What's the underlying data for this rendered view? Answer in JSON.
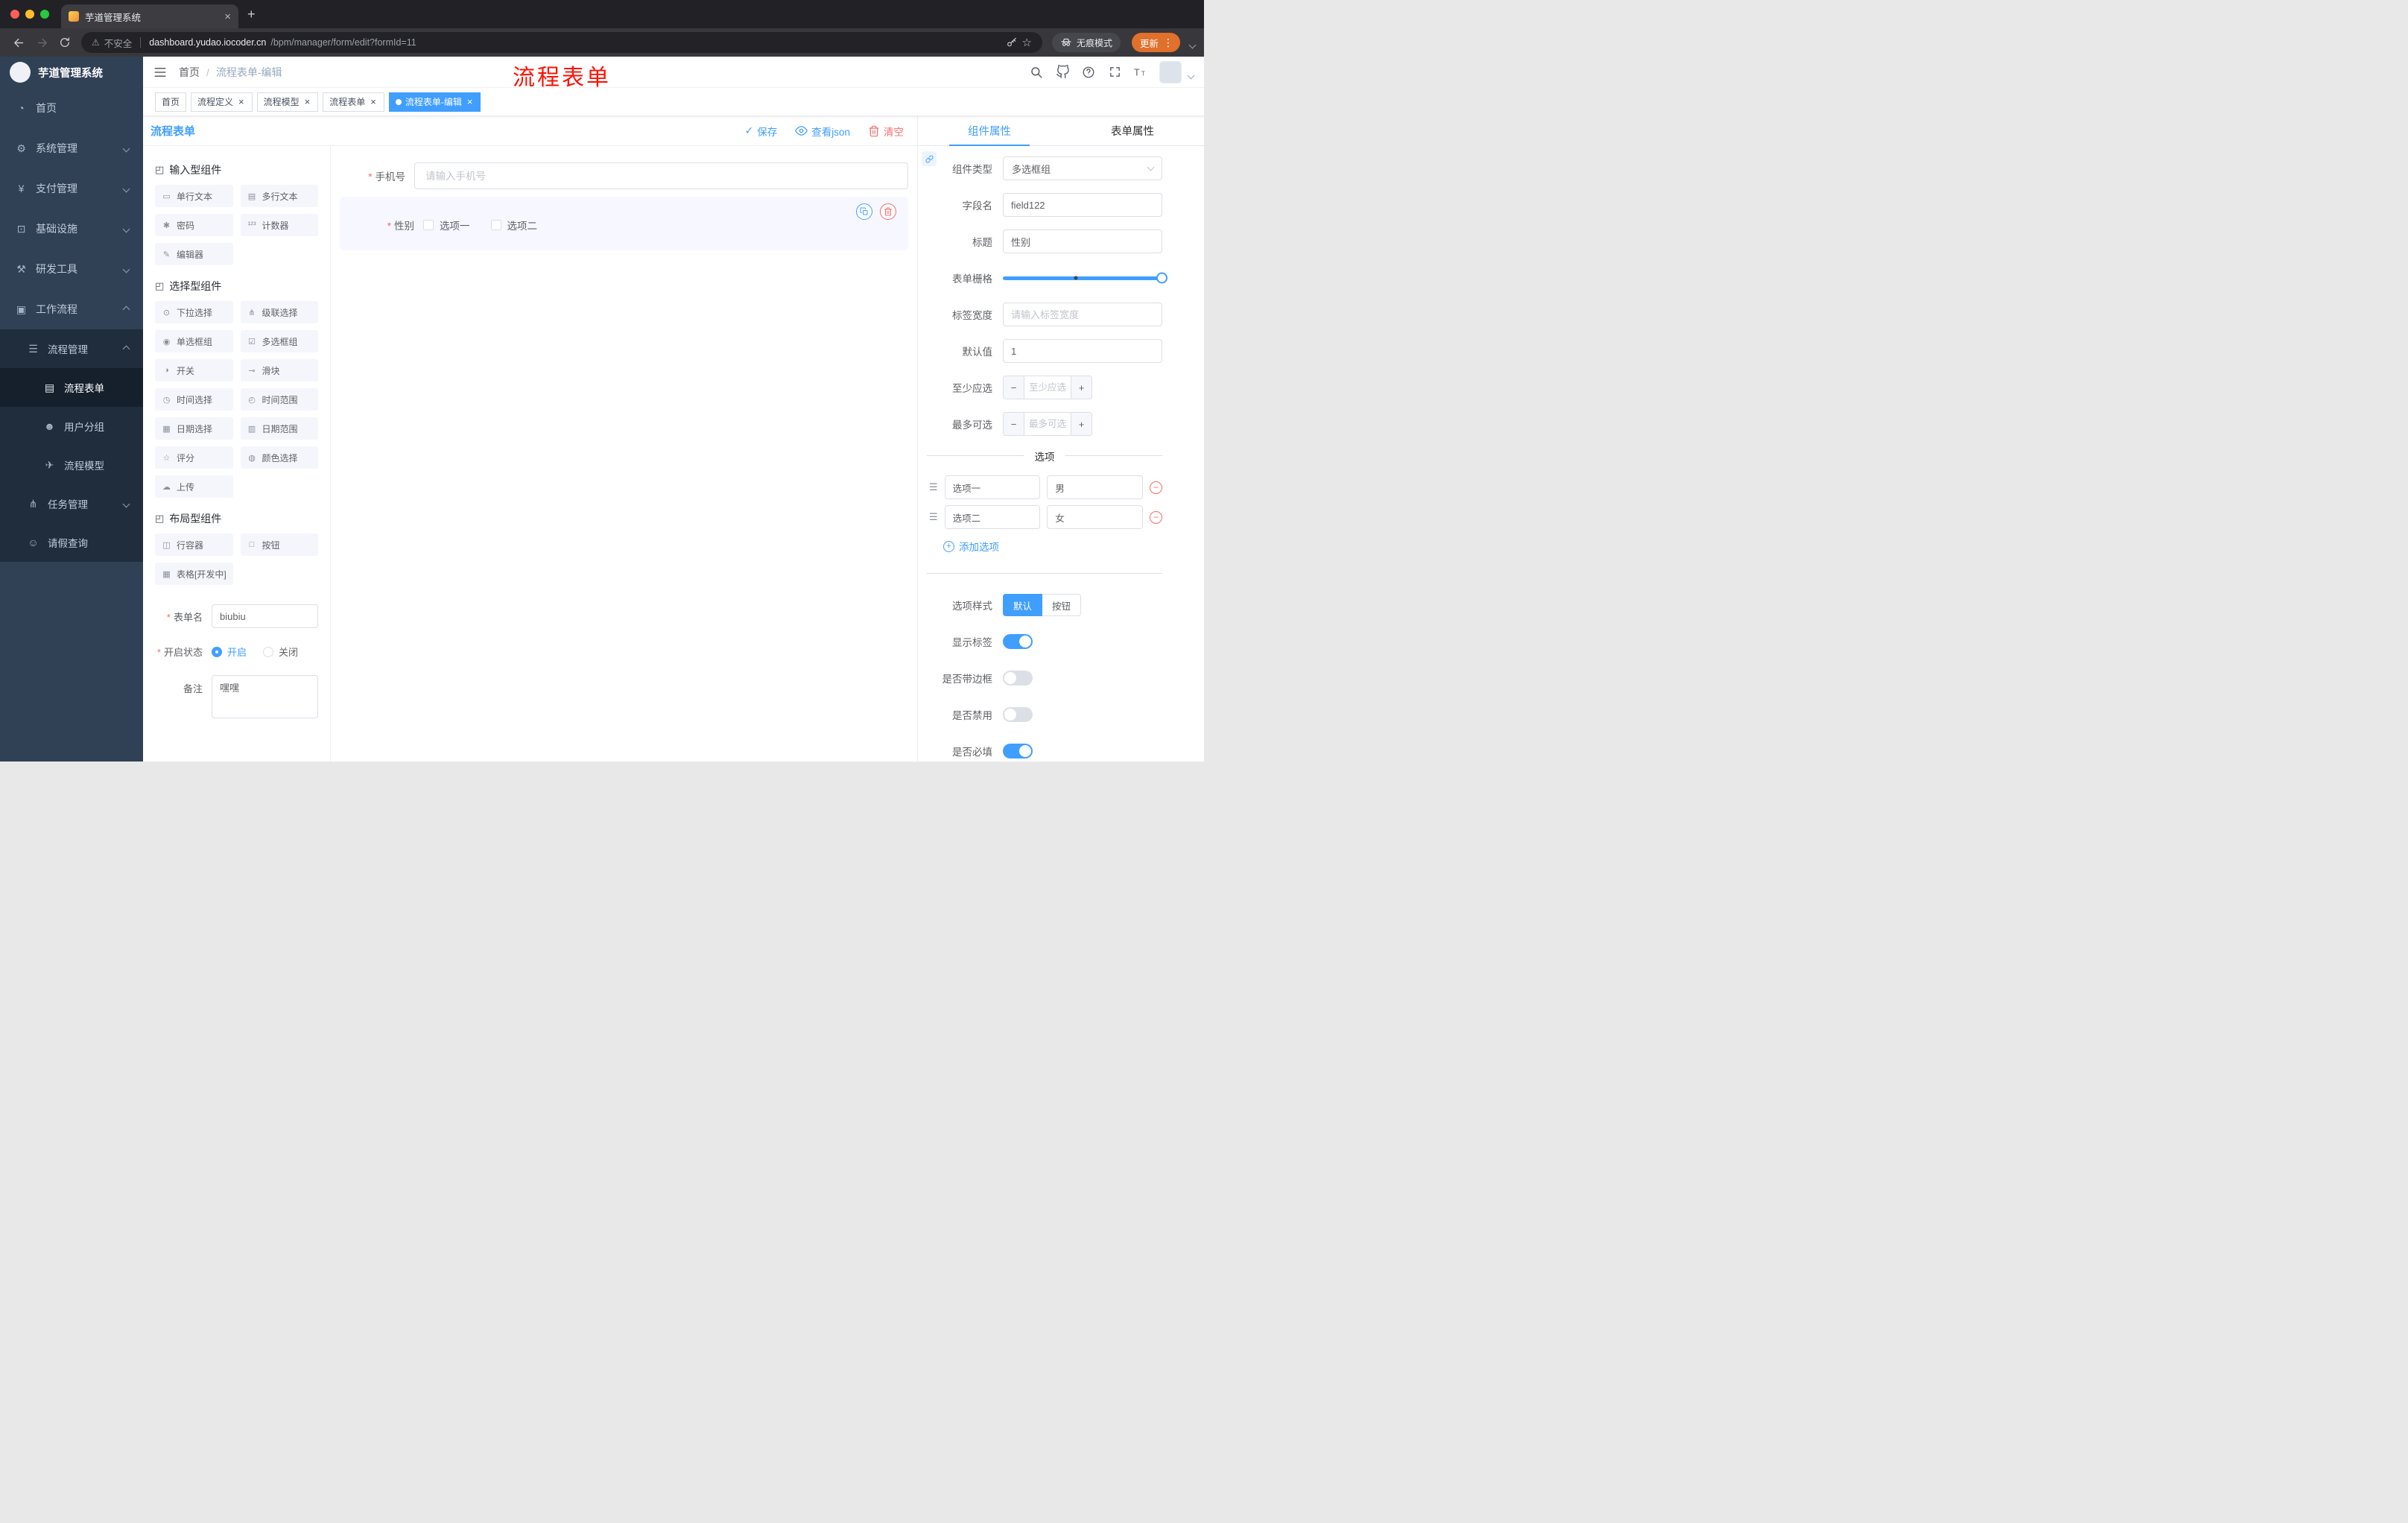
{
  "browser": {
    "tab_title": "芋道管理系统",
    "security_label": "不安全",
    "url_host": "dashboard.yudao.iocoder.cn",
    "url_path": "/bpm/manager/form/edit?formId=11",
    "incognito_label": "无痕模式",
    "update_label": "更新"
  },
  "annotation": {
    "text": "流程表单"
  },
  "sidebar": {
    "logo_title": "芋道管理系统",
    "menu": [
      {
        "label": "首页",
        "icon": "dashboard",
        "caret": ""
      },
      {
        "label": "系统管理",
        "icon": "gear",
        "caret": "down"
      },
      {
        "label": "支付管理",
        "icon": "yen",
        "caret": "down"
      },
      {
        "label": "基础设施",
        "icon": "monitor",
        "caret": "down"
      },
      {
        "label": "研发工具",
        "icon": "tools",
        "caret": "down"
      },
      {
        "label": "工作流程",
        "icon": "workflow",
        "caret": "up"
      }
    ],
    "submenu": [
      {
        "label": "流程管理",
        "icon": "list",
        "caret": "up"
      },
      {
        "label": "流程表单",
        "icon": "document",
        "sub": true,
        "active": true
      },
      {
        "label": "用户分组",
        "icon": "users",
        "sub": true
      },
      {
        "label": "流程模型",
        "icon": "send",
        "sub": true
      },
      {
        "label": "任务管理",
        "icon": "tree",
        "caret": "down"
      },
      {
        "label": "请假查询",
        "icon": "user",
        "caret": ""
      }
    ]
  },
  "header": {
    "breadcrumb_root": "首页",
    "breadcrumb_sep": "/",
    "breadcrumb_current": "流程表单-编辑"
  },
  "tags": [
    {
      "label": "首页"
    },
    {
      "label": "流程定义",
      "closable": true
    },
    {
      "label": "流程模型",
      "closable": true
    },
    {
      "label": "流程表单",
      "closable": true
    },
    {
      "label": "流程表单-编辑",
      "closable": true,
      "active": true
    }
  ],
  "designer": {
    "title": "流程表单",
    "save": "保存",
    "view_json": "查看json",
    "clear": "清空"
  },
  "palette": {
    "input_section": {
      "title": "输入型组件",
      "items": [
        {
          "label": "单行文本",
          "icon": "input"
        },
        {
          "label": "多行文本",
          "icon": "textarea"
        },
        {
          "label": "密码",
          "icon": "password"
        },
        {
          "label": "计数器",
          "icon": "counter"
        },
        {
          "label": "编辑器",
          "icon": "editor"
        }
      ]
    },
    "select_section": {
      "title": "选择型组件",
      "items": [
        {
          "label": "下拉选择",
          "icon": "select"
        },
        {
          "label": "级联选择",
          "icon": "cascader"
        },
        {
          "label": "单选框组",
          "icon": "radio"
        },
        {
          "label": "多选框组",
          "icon": "checkbox"
        },
        {
          "label": "开关",
          "icon": "switch"
        },
        {
          "label": "滑块",
          "icon": "slider"
        },
        {
          "label": "时间选择",
          "icon": "time"
        },
        {
          "label": "时间范围",
          "icon": "time-range"
        },
        {
          "label": "日期选择",
          "icon": "date"
        },
        {
          "label": "日期范围",
          "icon": "date-range"
        },
        {
          "label": "评分",
          "icon": "rate"
        },
        {
          "label": "颜色选择",
          "icon": "color"
        },
        {
          "label": "上传",
          "icon": "upload"
        }
      ]
    },
    "layout_section": {
      "title": "布局型组件",
      "items": [
        {
          "label": "行容器",
          "icon": "row"
        },
        {
          "label": "按钮",
          "icon": "button"
        },
        {
          "label": "表格[开发中]",
          "icon": "table"
        }
      ]
    },
    "form_config": {
      "name_label": "表单名",
      "name_value": "biubiu",
      "status_label": "开启状态",
      "status_on": "开启",
      "status_off": "关闭",
      "remark_label": "备注",
      "remark_value": "嘿嘿"
    }
  },
  "canvas": {
    "phone_label": "手机号",
    "phone_placeholder": "请输入手机号",
    "gender_label": "性别",
    "gender_options": [
      "选项一",
      "选项二"
    ]
  },
  "inspector": {
    "tab_component": "组件属性",
    "tab_form": "表单属性",
    "rows": {
      "component_type_label": "组件类型",
      "component_type_value": "多选框组",
      "field_name_label": "字段名",
      "field_name_value": "field122",
      "title_label": "标题",
      "title_value": "性别",
      "grid_label": "表单栅格",
      "grid_fill_percent": 100,
      "label_width_label": "标签宽度",
      "label_width_placeholder": "请输入标签宽度",
      "default_label": "默认值",
      "default_value": "1",
      "min_label": "至少应选",
      "min_placeholder": "至少应选",
      "max_label": "最多可选",
      "max_placeholder": "最多可选"
    },
    "options_divider": "选项",
    "options": [
      {
        "label": "选项一",
        "value": "男"
      },
      {
        "label": "选项二",
        "value": "女"
      }
    ],
    "add_option": "添加选项",
    "style_label": "选项样式",
    "style_options": [
      "默认",
      "按钮"
    ],
    "style_selected": "默认",
    "switches": [
      {
        "label": "显示标签",
        "on": true
      },
      {
        "label": "是否带边框",
        "on": false
      },
      {
        "label": "是否禁用",
        "on": false
      },
      {
        "label": "是否必填",
        "on": true
      }
    ]
  },
  "colors": {
    "primary": "#409eff",
    "danger": "#f56c6c",
    "annotation_red": "#fd1205",
    "update_pill_orange": "#e0702b",
    "sidebar_bg": "#304156",
    "submenu_bg": "#1f2d3d"
  }
}
